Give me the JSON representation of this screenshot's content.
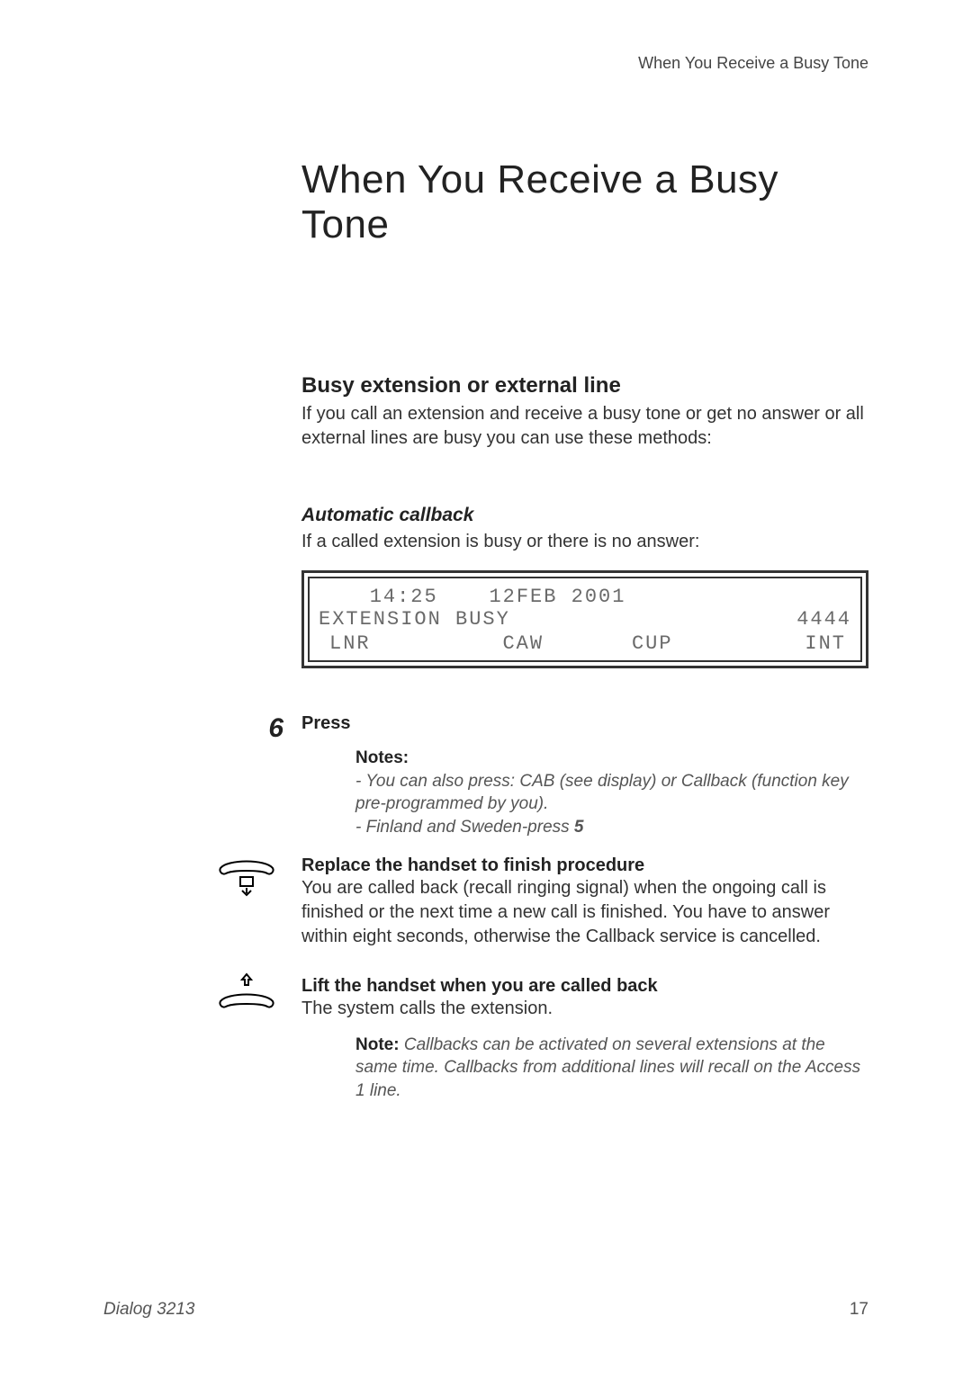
{
  "running_head": "When You Receive a Busy Tone",
  "chapter_title": "When You Receive a Busy Tone",
  "section": {
    "heading": "Busy extension or external line",
    "intro": "If you call an extension and receive a busy tone or get no answer or all external lines are busy you can use these methods:"
  },
  "subsection": {
    "heading": "Automatic callback",
    "intro": "If a called extension is busy or there is no answer:"
  },
  "lcd": {
    "time": "14:25",
    "date": "12FEB 2001",
    "status": "EXTENSION BUSY",
    "ext": "4444",
    "softkeys": [
      "LNR",
      "CAW",
      "CUP",
      "INT"
    ]
  },
  "steps": {
    "press": {
      "key_digit": "6",
      "title": "Press",
      "notes_label": "Notes:",
      "note_line1": "- You can also press: CAB (see display) or Callback (function key pre-programmed by you).",
      "note_line2_prefix": "- Finland and Sweden-press ",
      "note_line2_digit": "5"
    },
    "replace": {
      "title": "Replace the handset to finish procedure",
      "body": "You are called back (recall ringing signal) when the ongoing call is finished or the next time a new call is finished. You have to answer within eight seconds, otherwise the Callback service is cancelled."
    },
    "lift": {
      "title": "Lift the handset when you are called back",
      "body": "The system calls the extension.",
      "note_label": "Note:",
      "note_body": " Callbacks can be activated on several extensions at the same time. Callbacks from additional lines will recall on the Access 1 line."
    }
  },
  "footer": {
    "model": "Dialog 3213",
    "page": "17"
  }
}
